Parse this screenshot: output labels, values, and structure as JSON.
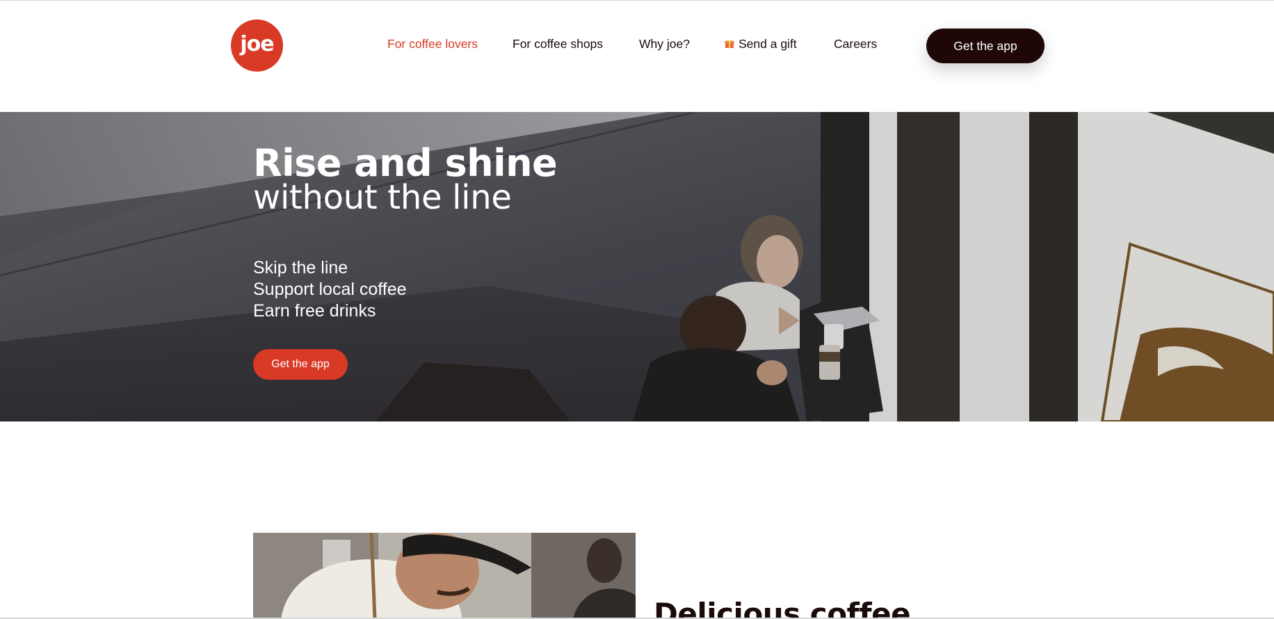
{
  "brand": {
    "logo_text": "joe",
    "accent_color": "#d93a25",
    "dark_color": "#1f0707"
  },
  "nav": {
    "items": [
      {
        "label": "For coffee lovers",
        "active": true
      },
      {
        "label": "For coffee shops",
        "active": false
      },
      {
        "label": "Why joe?",
        "active": false
      },
      {
        "label": "Send a gift",
        "active": false,
        "icon": "gift-icon"
      },
      {
        "label": "Careers",
        "active": false
      }
    ],
    "cta_label": "Get the app"
  },
  "hero": {
    "title_bold": "Rise and shine",
    "title_light": "without the line",
    "points": [
      "Skip the line",
      "Support local coffee",
      "Earn free drinks"
    ],
    "cta_label": "Get the app",
    "image": "hero-cafe-photo"
  },
  "section2": {
    "title": "Delicious coffee",
    "image": "barista-photo"
  }
}
